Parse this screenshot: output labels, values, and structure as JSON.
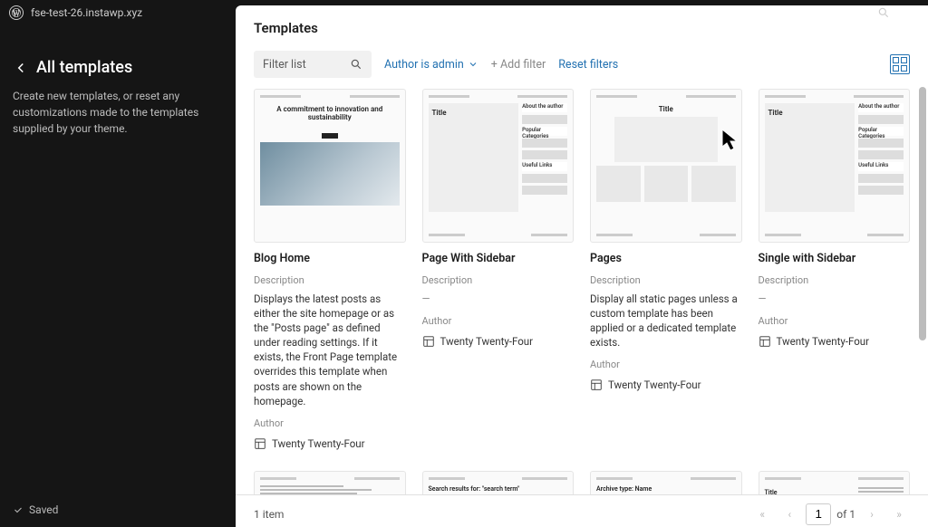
{
  "topbar": {
    "site_name": "fse-test-26.instawp.xyz"
  },
  "sidebar": {
    "title": "All templates",
    "description": "Create new templates, or reset any customizations made to the templates supplied by your theme.",
    "saved_label": "Saved"
  },
  "panel": {
    "header": "Templates",
    "filter_placeholder": "Filter list",
    "author_filter": "Author is admin",
    "add_filter": "+  Add filter",
    "reset_filters": "Reset filters"
  },
  "templates": [
    {
      "name": "Blog Home",
      "desc_label": "Description",
      "desc": "Displays the latest posts as either the site homepage or as the \"Posts page\" as defined under reading settings. If it exists, the Front Page template overrides this template when posts are shown on the homepage.",
      "author_label": "Author",
      "author": "Twenty Twenty-Four",
      "thumb_type": "hero"
    },
    {
      "name": "Page With Sidebar",
      "desc_label": "Description",
      "desc": "—",
      "author_label": "Author",
      "author": "Twenty Twenty-Four",
      "thumb_type": "sidebar"
    },
    {
      "name": "Pages",
      "desc_label": "Description",
      "desc": "Display all static pages unless a custom template has been applied or a dedicated template exists.",
      "author_label": "Author",
      "author": "Twenty Twenty-Four",
      "thumb_type": "page"
    },
    {
      "name": "Single with Sidebar",
      "desc_label": "Description",
      "desc": "—",
      "author_label": "Author",
      "author": "Twenty Twenty-Four",
      "thumb_type": "sidebar"
    }
  ],
  "row2": [
    {
      "heading": "",
      "type": "text"
    },
    {
      "heading": "Search results for: \"search term\"",
      "type": "search"
    },
    {
      "heading": "Archive type: Name",
      "type": "archive"
    },
    {
      "heading": "Title",
      "type": "title"
    }
  ],
  "footer": {
    "count": "1 item",
    "page_current": "1",
    "page_of": "of 1"
  }
}
